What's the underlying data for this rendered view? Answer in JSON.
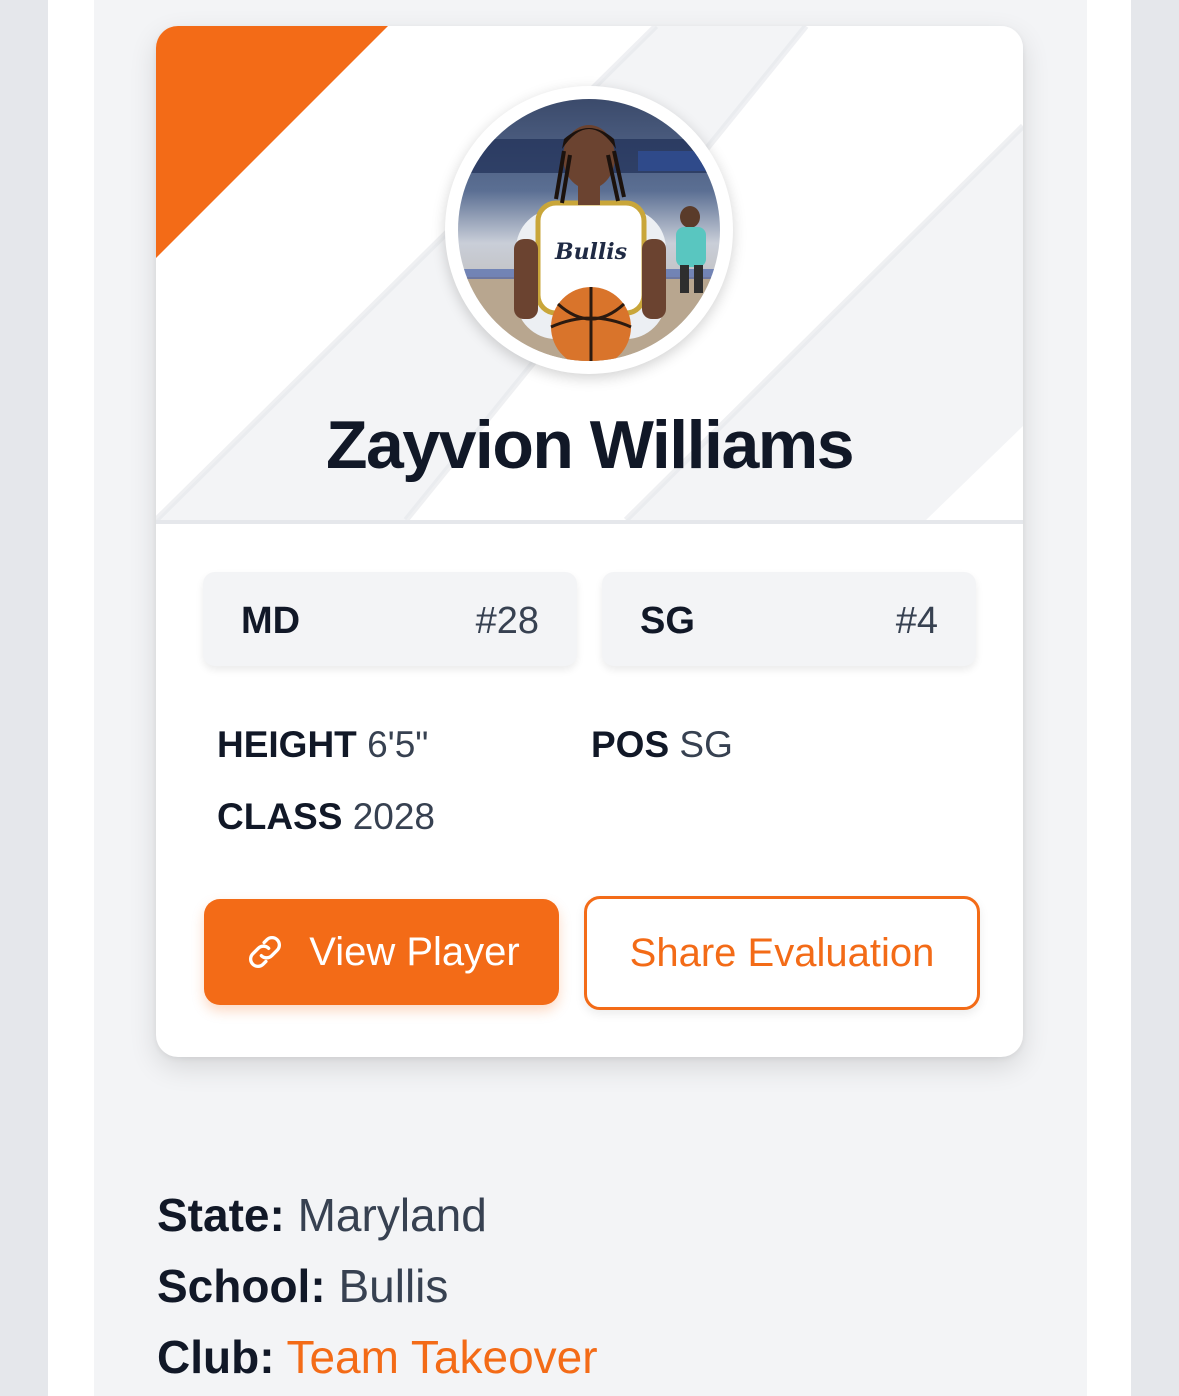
{
  "player": {
    "name": "Zayvion Williams",
    "photo_alt": "Player photo"
  },
  "rankings": [
    {
      "label": "MD",
      "value": "#28"
    },
    {
      "label": "SG",
      "value": "#4"
    }
  ],
  "stats": {
    "height_label": "HEIGHT",
    "height_value": "6'5\"",
    "pos_label": "POS",
    "pos_value": "SG",
    "class_label": "CLASS",
    "class_value": "2028"
  },
  "buttons": {
    "view_player": "View Player",
    "share_evaluation": "Share Evaluation",
    "view_player_icon": "link-icon"
  },
  "info": {
    "state_label": "State:",
    "state_value": "Maryland",
    "school_label": "School:",
    "school_value": "Bullis",
    "club_label": "Club:",
    "club_value": "Team Takeover"
  },
  "colors": {
    "accent": "#f36b17",
    "text_dark": "#111827",
    "text_muted": "#374151",
    "panel_bg": "#f3f4f6"
  }
}
